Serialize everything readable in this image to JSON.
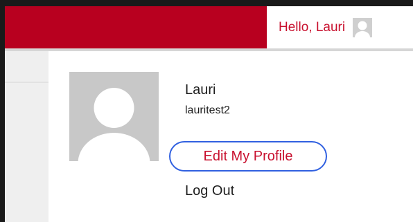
{
  "header": {
    "greeting": "Hello, Lauri",
    "avatar_icon": "user-avatar-placeholder-icon",
    "brand_color": "#b8001f"
  },
  "profile_menu": {
    "display_name": "Lauri",
    "username": "lauritest2",
    "avatar_icon": "user-avatar-placeholder-icon",
    "edit_profile_label": "Edit My Profile",
    "logout_label": "Log Out",
    "link_color": "#c8102e",
    "focus_ring_color": "#3060e0"
  }
}
